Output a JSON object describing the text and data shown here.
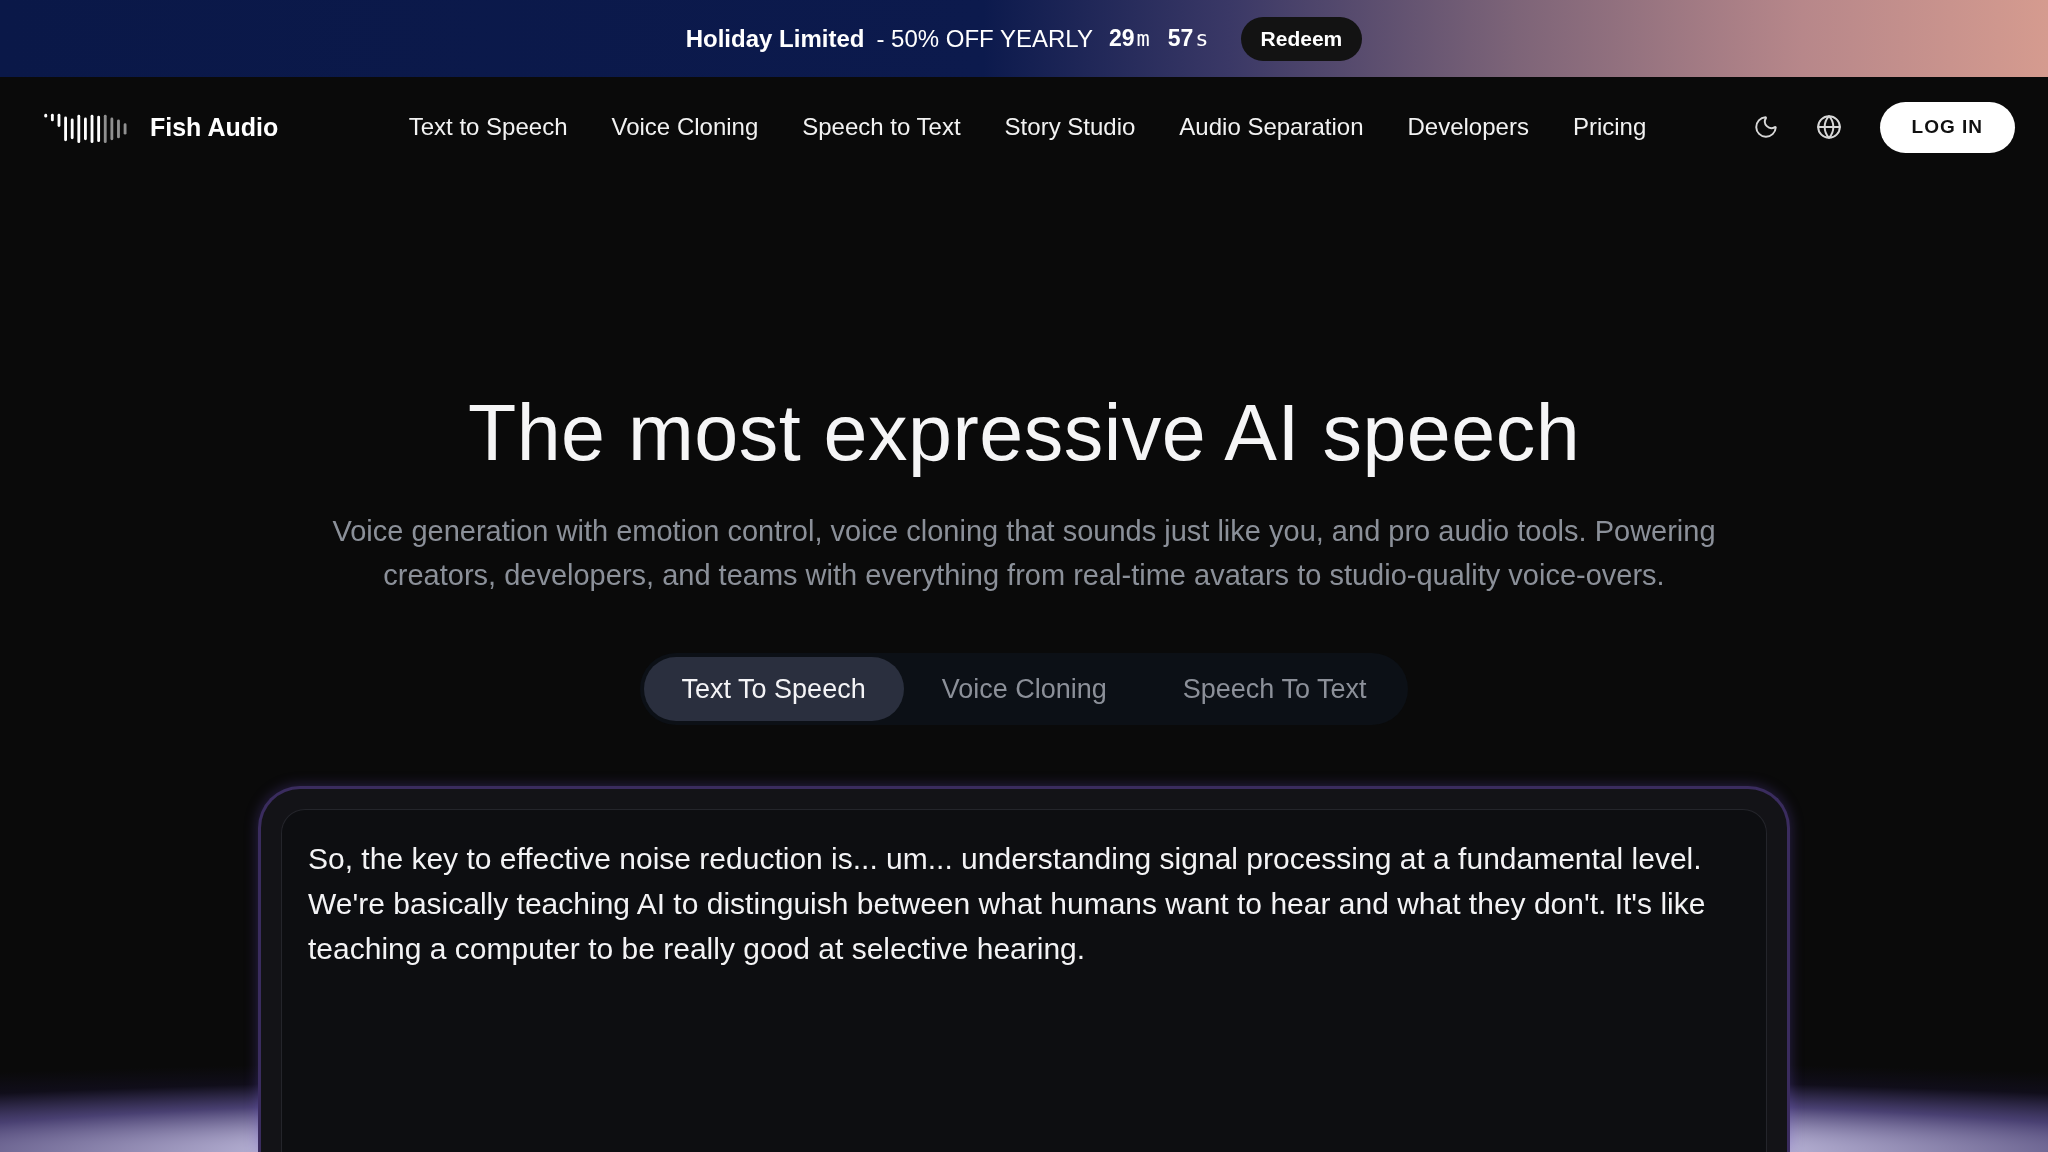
{
  "banner": {
    "title": "Holiday Limited",
    "offer": "- 50% OFF YEARLY",
    "countdown": [
      {
        "value": "29",
        "unit": "m"
      },
      {
        "value": "57",
        "unit": "s"
      }
    ],
    "button": "Redeem"
  },
  "nav": {
    "brand": "Fish Audio",
    "links": [
      "Text to Speech",
      "Voice Cloning",
      "Speech to Text",
      "Story Studio",
      "Audio Separation",
      "Developers",
      "Pricing"
    ],
    "login": "LOG IN"
  },
  "hero": {
    "title": "The most expressive AI speech",
    "subtitle": "Voice generation with emotion control, voice cloning that sounds just like you, and pro audio tools. Powering creators, developers, and teams with everything from real-time avatars to studio-quality voice-overs."
  },
  "mode_tabs": [
    {
      "label": "Text To Speech",
      "selected": true
    },
    {
      "label": "Voice Cloning",
      "selected": false
    },
    {
      "label": "Speech To Text",
      "selected": false
    }
  ],
  "editor": {
    "value": "So, the key to effective noise reduction is... um... understanding signal processing at a fundamental level. We're basically teaching AI to distinguish between what humans want to hear and what they don't. It's like teaching a computer to be really good at selective hearing."
  }
}
